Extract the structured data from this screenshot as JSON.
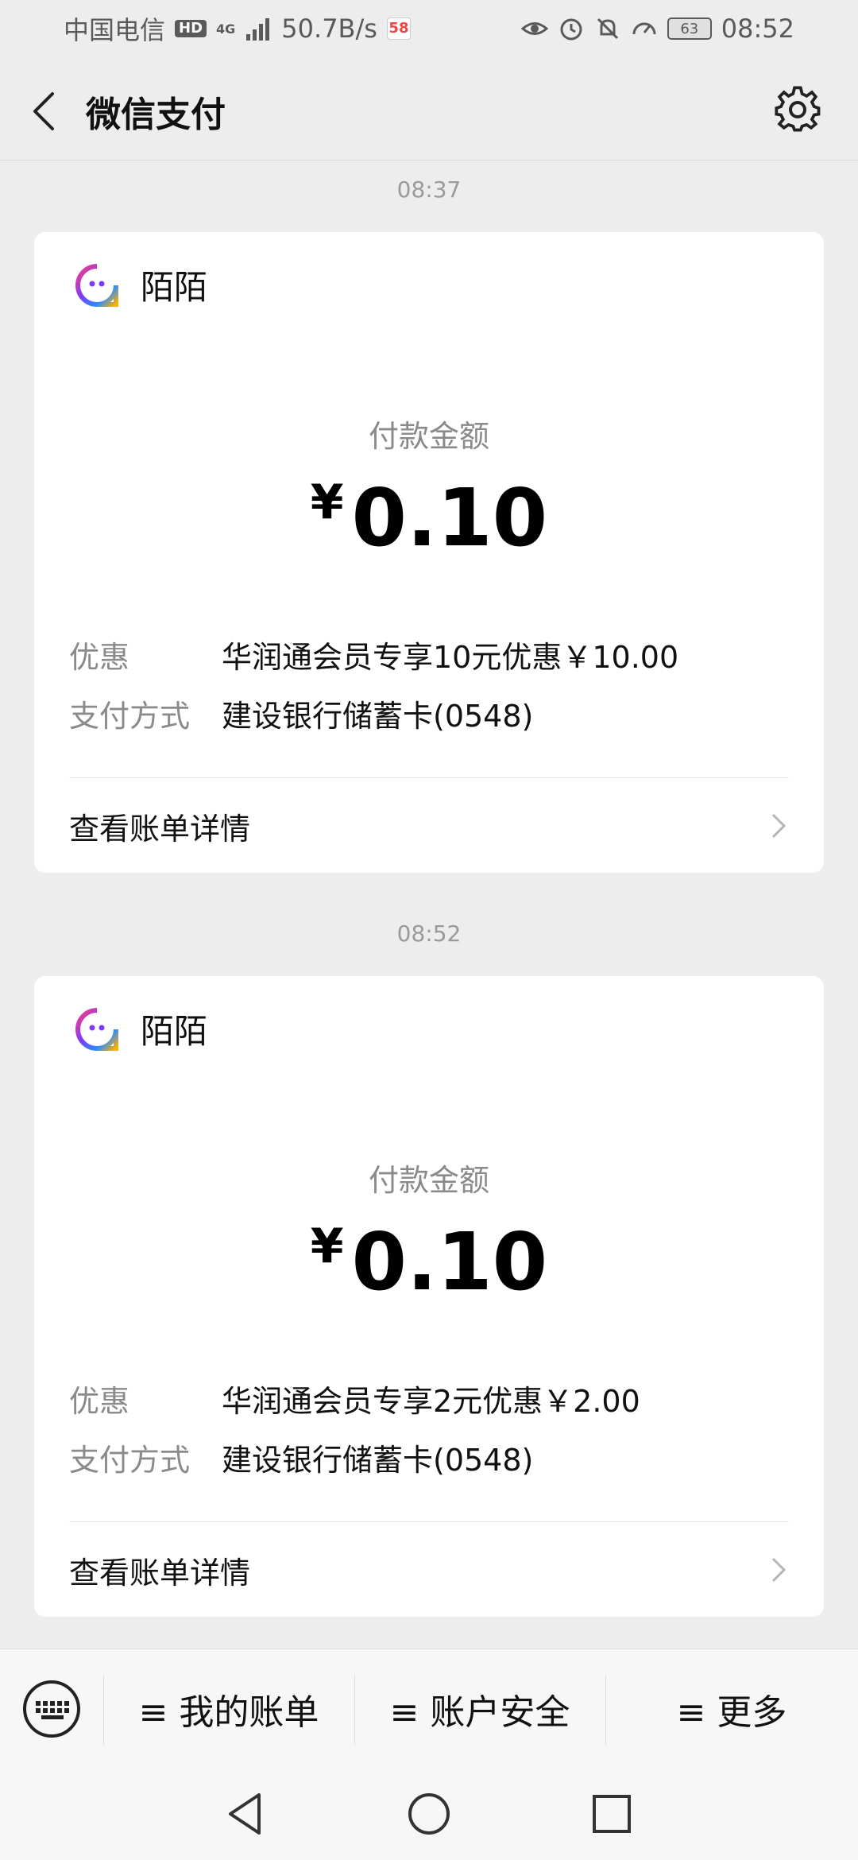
{
  "status_bar": {
    "carrier": "中国电信",
    "hd": "HD",
    "network": "4G",
    "speed": "50.7B/s",
    "app_badge": "58",
    "battery": "63",
    "time": "08:52"
  },
  "header": {
    "title": "微信支付"
  },
  "messages": [
    {
      "time": "08:37",
      "merchant": "陌陌",
      "amount_label": "付款金额",
      "currency": "¥",
      "amount": "0.10",
      "discount_label": "优惠",
      "discount_value": "华润通会员专享10元优惠￥10.00",
      "method_label": "支付方式",
      "method_value": "建设银行储蓄卡(0548)",
      "details_link": "查看账单详情"
    },
    {
      "time": "08:52",
      "merchant": "陌陌",
      "amount_label": "付款金额",
      "currency": "¥",
      "amount": "0.10",
      "discount_label": "优惠",
      "discount_value": "华润通会员专享2元优惠￥2.00",
      "method_label": "支付方式",
      "method_value": "建设银行储蓄卡(0548)",
      "details_link": "查看账单详情"
    }
  ],
  "bottom_menu": {
    "items": [
      "≡ 我的账单",
      "≡ 账户安全",
      "≡ 更多"
    ]
  },
  "colors": {
    "background": "#ededed",
    "card": "#ffffff",
    "text_primary": "#111111",
    "text_secondary": "#8a8a8a",
    "merchant_logo_gradient": [
      "#ff3d7f",
      "#7b3cff",
      "#2b8cff",
      "#ffb100"
    ]
  }
}
